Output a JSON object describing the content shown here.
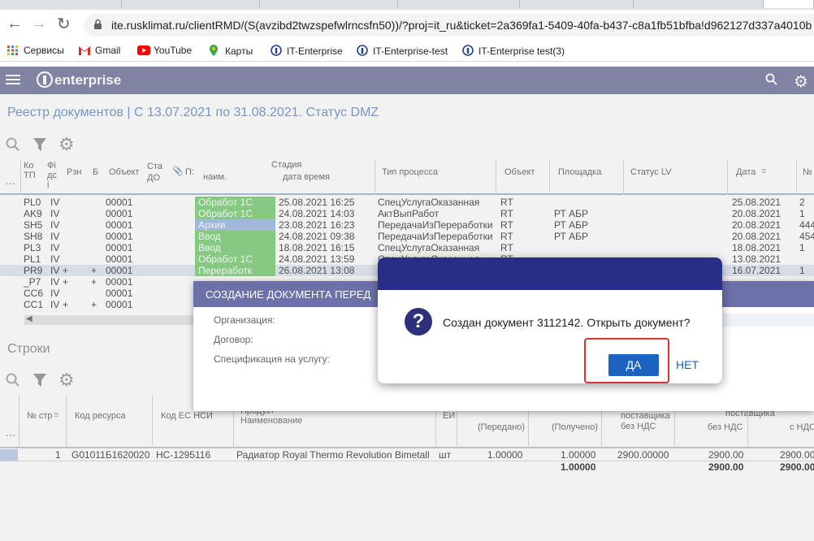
{
  "browser": {
    "url": "ite.rusklimat.ru/clientRMD/(S(avzibd2twzspefwlrncsfn50))/?proj=it_ru&ticket=2a369fa1-5409-40fa-b437-c8a1fb51bfba!d962127d337a4010b",
    "bookmarks": [
      {
        "label": "Сервисы",
        "icon": "apps-icon"
      },
      {
        "label": "Gmail",
        "icon": "gmail-icon"
      },
      {
        "label": "YouTube",
        "icon": "youtube-icon"
      },
      {
        "label": "Карты",
        "icon": "maps-icon"
      },
      {
        "label": "IT-Enterprise",
        "icon": "it-enterprise-icon"
      },
      {
        "label": "IT-Enterprise-test",
        "icon": "it-enterprise-icon"
      },
      {
        "label": "IT-Enterprise test(3)",
        "icon": "it-enterprise-icon"
      }
    ]
  },
  "app": {
    "logo_text": "enterprise",
    "page_title": "Реестр документов | С 13.07.2021 по 31.08.2021. Статус DMZ",
    "rows_title": "Строки"
  },
  "docs_table": {
    "headers": {
      "kod_tp": "Ко\nТП",
      "fi": "Фі\nдс\nі",
      "rzn": "Рзн",
      "b": "Б",
      "object1": "Объект",
      "stat_do": "Ста\nДО",
      "p": "П:",
      "stage": "Стадия",
      "stage_name": "наим.",
      "stage_date": "дата время",
      "process_type": "Тип процесса",
      "object2": "Объект",
      "site": "Площадка",
      "status_lv": "Статус LV",
      "date": "Дата",
      "num": "№"
    },
    "rows": [
      {
        "kod": "PL0",
        "fi": "IV",
        "rzn": "",
        "b": "",
        "obj": "00001",
        "stage": "Обработ 1С",
        "stage_color": "#8fd48a",
        "dt": "25.08.2021 16:25",
        "proc": "СпецУслугаОказанная",
        "obj2": "RT",
        "site": "",
        "date": "25.08.2021",
        "num": "2"
      },
      {
        "kod": "AK9",
        "fi": "IV",
        "rzn": "",
        "b": "",
        "obj": "00001",
        "stage": "Обработ 1С",
        "stage_color": "#8fd48a",
        "dt": "24.08.2021 14:03",
        "proc": "АктВыпРабот",
        "obj2": "RT",
        "site": "РТ АБР",
        "date": "20.08.2021",
        "num": "1"
      },
      {
        "kod": "SH5",
        "fi": "IV",
        "rzn": "",
        "b": "",
        "obj": "00001",
        "stage": "Архив",
        "stage_color": "#a9c1e6",
        "dt": "23.08.2021 16:23",
        "proc": "ПередачаИзПереработки",
        "obj2": "RT",
        "site": "РТ АБР",
        "date": "20.08.2021",
        "num": "444"
      },
      {
        "kod": "SH8",
        "fi": "IV",
        "rzn": "",
        "b": "",
        "obj": "00001",
        "stage": "Ввод",
        "stage_color": "#8fd48a",
        "dt": "24.08.2021 09:38",
        "proc": "ПередачаИзПереработки",
        "obj2": "RT",
        "site": "РТ АБР",
        "date": "20.08.2021",
        "num": "454"
      },
      {
        "kod": "PL3",
        "fi": "IV",
        "rzn": "",
        "b": "",
        "obj": "00001",
        "stage": "Ввод",
        "stage_color": "#8fd48a",
        "dt": "18.08.2021 16:15",
        "proc": "СпецУслугаОказанная",
        "obj2": "RT",
        "site": "",
        "date": "18.08.2021",
        "num": "1"
      },
      {
        "kod": "PL1",
        "fi": "IV",
        "rzn": "",
        "b": "",
        "obj": "00001",
        "stage": "Обработ 1С",
        "stage_color": "#8fd48a",
        "dt": "24.08.2021 13:59",
        "proc": "СпецУслугаОказанная",
        "obj2": "RT",
        "site": "",
        "date": "13.08.2021",
        "num": ""
      },
      {
        "kod": "PR9",
        "fi": "IV",
        "rzn": "+",
        "b": "+",
        "obj": "00001",
        "stage": "Переработк",
        "stage_color": "#8fd48a",
        "dt": "26.08.2021 13:08",
        "proc": "",
        "obj2": "",
        "site": "",
        "date": "16.07.2021",
        "num": "1"
      },
      {
        "kod": "_P7",
        "fi": "IV",
        "rzn": "+",
        "b": "+",
        "obj": "00001",
        "stage": "",
        "stage_color": "",
        "dt": "",
        "proc": "",
        "obj2": "",
        "site": "",
        "date": "",
        "num": ""
      },
      {
        "kod": "CC6",
        "fi": "IV",
        "rzn": "",
        "b": "",
        "obj": "00001",
        "stage": "",
        "stage_color": "",
        "dt": "",
        "proc": "",
        "obj2": "",
        "site": "",
        "date": "",
        "num": ""
      },
      {
        "kod": "CC1",
        "fi": "IV",
        "rzn": "+",
        "b": "+",
        "obj": "00001",
        "stage": "",
        "stage_color": "",
        "dt": "",
        "proc": "",
        "obj2": "",
        "site": "",
        "date": "",
        "num": ""
      }
    ]
  },
  "lines_table": {
    "headers": {
      "num": "№ стр",
      "res_code": "Код ресурса",
      "es_code": "Код ЕС НСИ",
      "name_top": "Продукт",
      "name": "Наименование",
      "unit": "ЕИ",
      "sent": "(Передано)",
      "received": "(Получено)",
      "price_top": "поставщика",
      "price": "без НДС",
      "sum_top": "поставщика",
      "sum_no_vat": "без НДС",
      "sum_vat": "с НДС"
    },
    "row": {
      "num": "1",
      "res_code": "G01011Б1620020",
      "es_code": "НС-1295116",
      "name": "Радиатор Royal Thermo Revolution Bimetall",
      "unit": "шт",
      "sent": "1.00000",
      "received": "1.00000",
      "price": "2900.00000",
      "sum_no_vat": "2900.00",
      "sum_vat": "2900.00"
    },
    "totals": {
      "received": "1.00000",
      "sum_no_vat": "2900.00",
      "sum_vat": "2900.00"
    }
  },
  "create_dialog": {
    "title": "СОЗДАНИЕ ДОКУМЕНТА ПЕРЕД",
    "labels": [
      "Организация:",
      "Договор:",
      "Спецификация на услугу:"
    ]
  },
  "confirm_dialog": {
    "message": "Создан документ 3112142. Открыть документ?",
    "yes_label": "ДА",
    "no_label": "НЕТ"
  },
  "colors": {
    "appbar": "#878bab",
    "dialog_header": "#282e86",
    "back_dialog_header": "#6d71a9",
    "primary_button": "#1c63c1",
    "highlight_frame": "#e03131"
  }
}
